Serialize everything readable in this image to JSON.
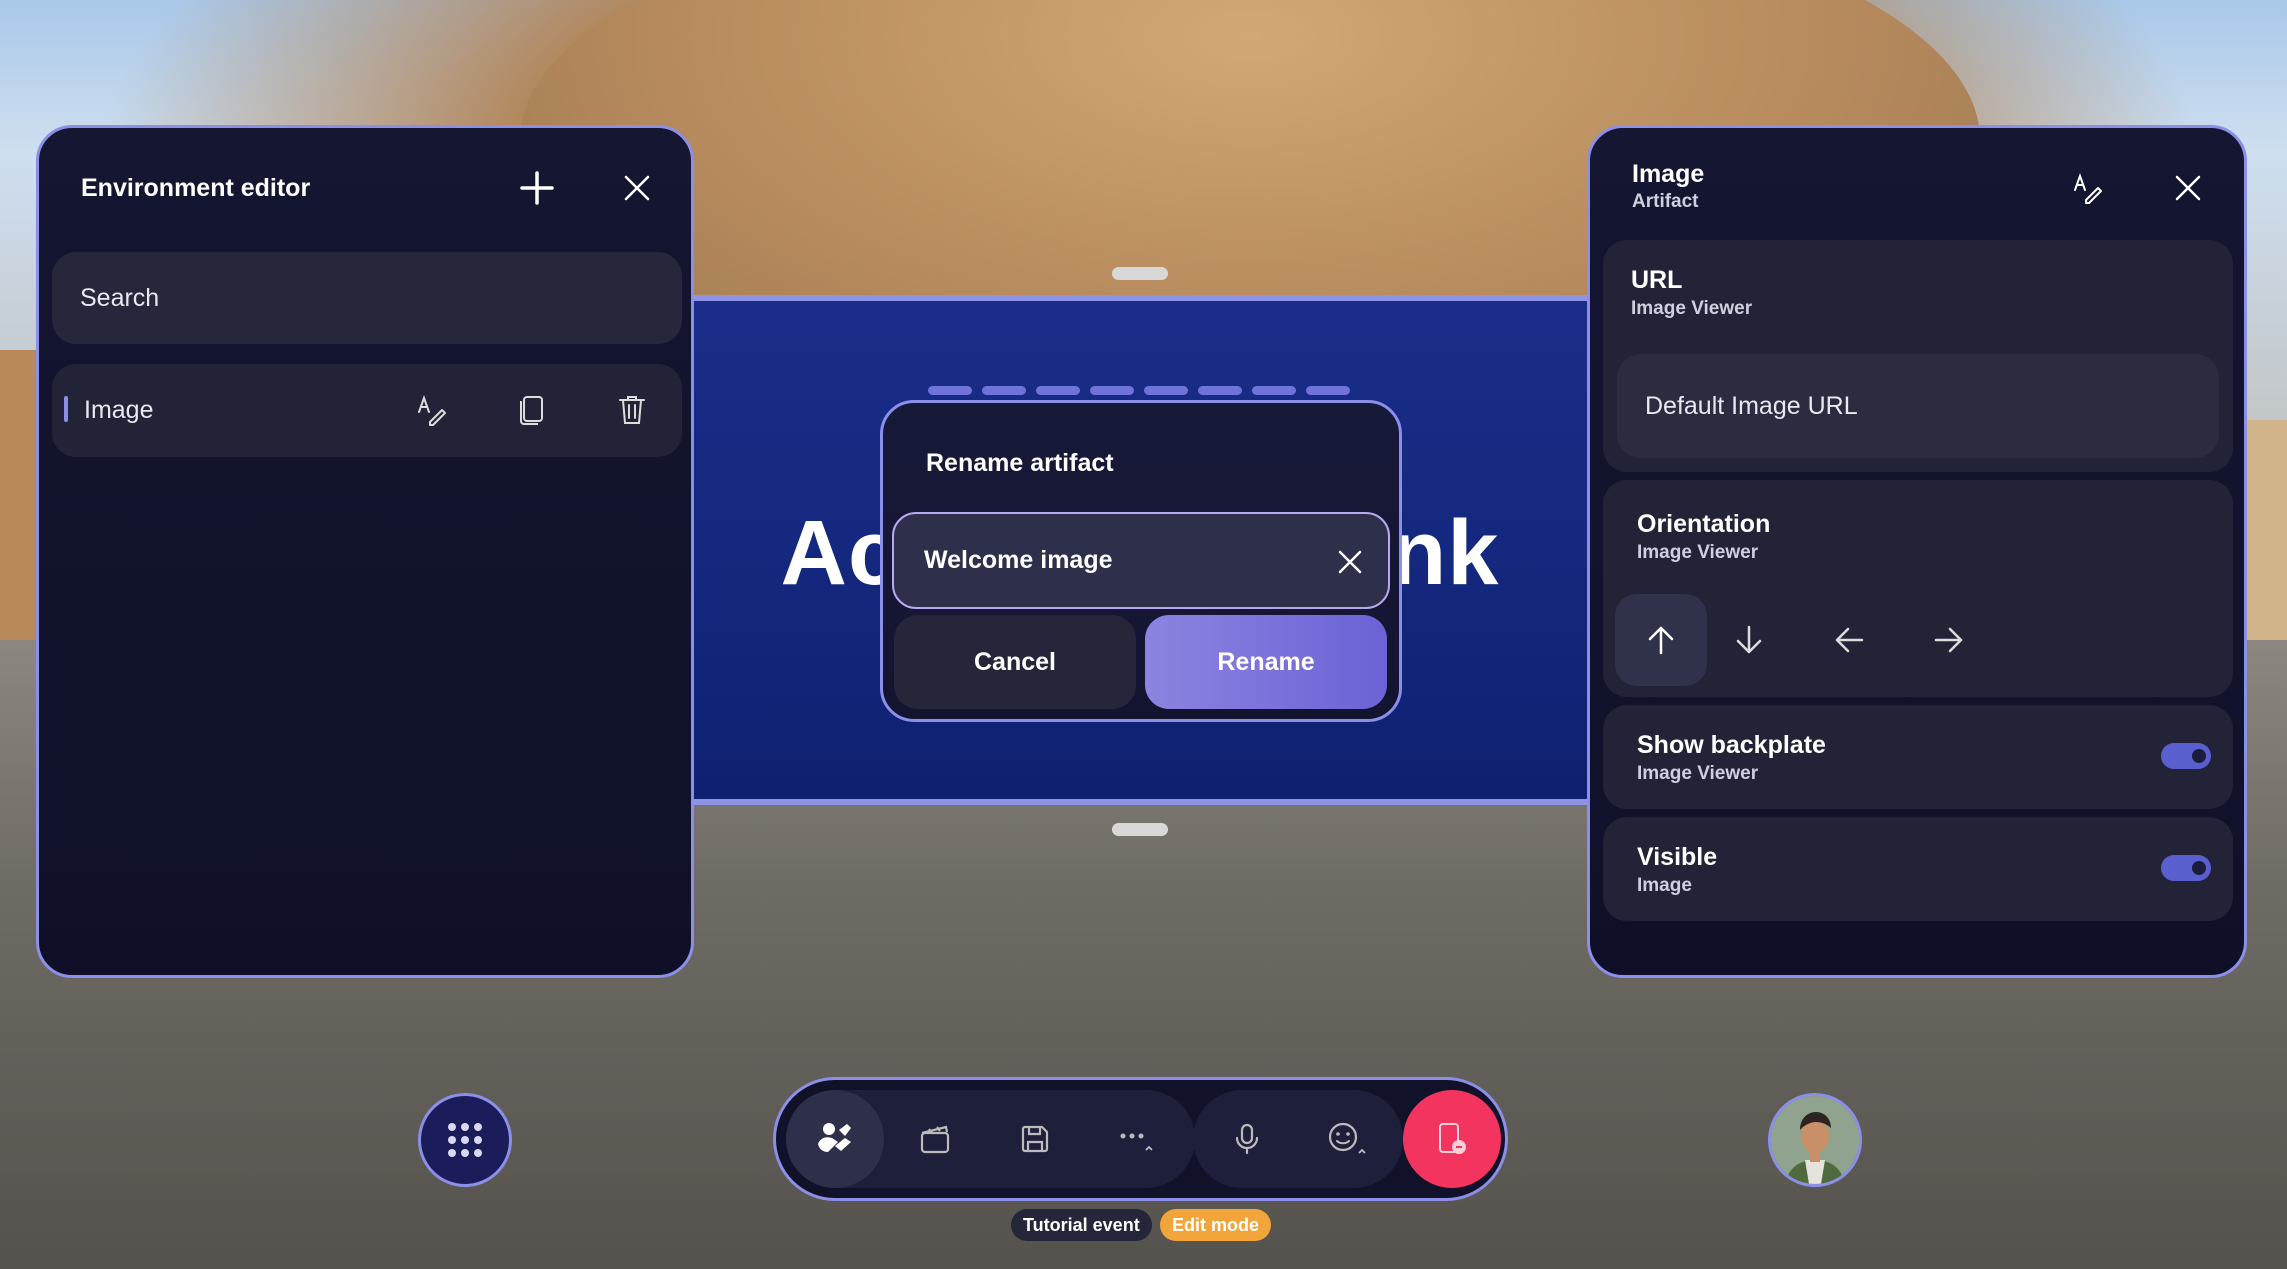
{
  "scene": {
    "screen_text_left": "Ac",
    "screen_text_right": "nk"
  },
  "environment_editor": {
    "title": "Environment editor",
    "search_placeholder": "Search",
    "items": [
      {
        "label": "Image"
      }
    ]
  },
  "properties": {
    "title": "Image",
    "subtitle": "Artifact",
    "url": {
      "title": "URL",
      "subtitle": "Image Viewer",
      "value": "Default Image URL"
    },
    "orientation": {
      "title": "Orientation",
      "subtitle": "Image Viewer",
      "selected": "up"
    },
    "show_backplate": {
      "title": "Show backplate",
      "subtitle": "Image Viewer",
      "on": true
    },
    "visible": {
      "title": "Visible",
      "subtitle": "Image",
      "on": true
    }
  },
  "rename_dialog": {
    "title": "Rename artifact",
    "value": "Welcome image",
    "cancel_label": "Cancel",
    "rename_label": "Rename"
  },
  "toolbar": {
    "items": [
      "host-tools-icon",
      "scene-icon",
      "save-icon",
      "more-icon",
      "microphone-icon",
      "emoji-icon",
      "leave-icon"
    ]
  },
  "status": {
    "event_label": "Tutorial event",
    "mode_label": "Edit mode"
  },
  "colors": {
    "accent": "#8b8fe8",
    "rename_button": "#7a72dc",
    "leave_button": "#f2345f",
    "edit_mode_chip": "#f2a53a"
  }
}
